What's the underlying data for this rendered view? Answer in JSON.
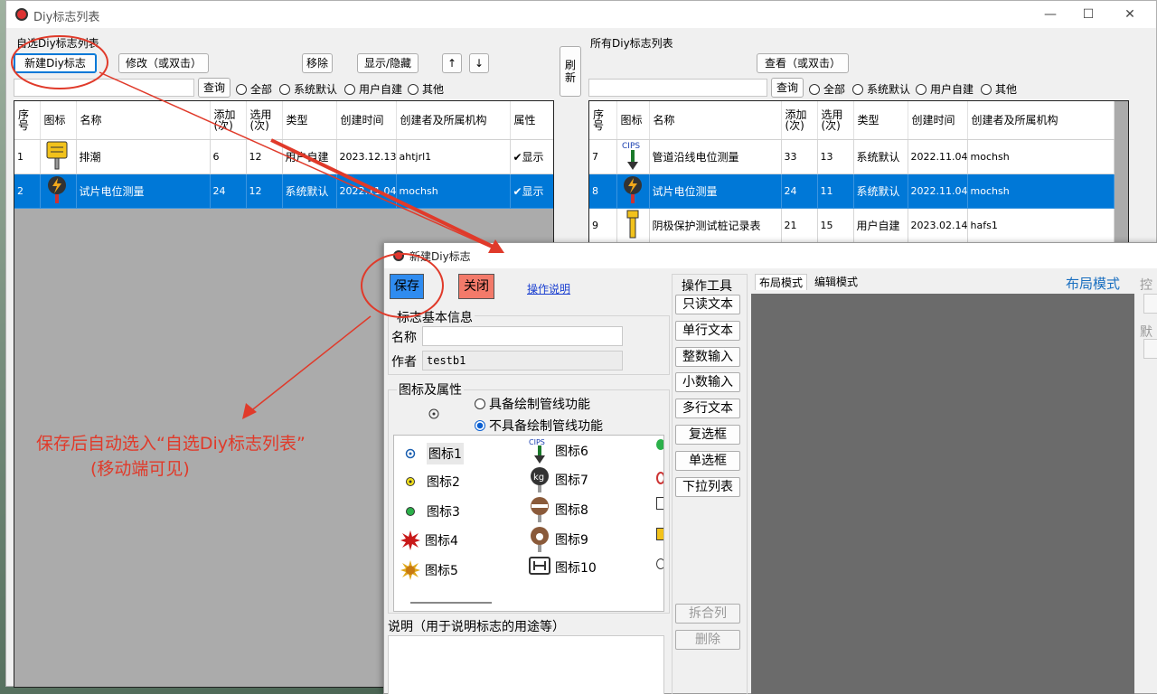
{
  "window": {
    "title": "Diy标志列表",
    "min": "—",
    "max": "☐",
    "close": "✕"
  },
  "left": {
    "section_label": "自选Diy标志列表",
    "new_btn": "新建Diy标志",
    "edit_btn": "修改（或双击）",
    "remove_btn": "移除",
    "toggle_btn": "显示/隐藏",
    "up_btn": "↑",
    "down_btn": "↓",
    "search_value": "",
    "query_btn": "查询",
    "filters": [
      "全部",
      "系统默认",
      "用户自建",
      "其他"
    ],
    "columns": [
      "序号",
      "图标",
      "名称",
      "添加(次)",
      "选用(次)",
      "类型",
      "创建时间",
      "创建者及所属机构",
      "属性"
    ],
    "rows": [
      {
        "no": "1",
        "name": "排潮",
        "add": "6",
        "use": "12",
        "type": "用户自建",
        "date": "2023.12.13",
        "creator": "ahtjrl1",
        "attr": "✔显示",
        "icon": "yellow-sign-icon",
        "selected": false
      },
      {
        "no": "2",
        "name": "试片电位测量",
        "add": "24",
        "use": "12",
        "type": "系统默认",
        "date": "2022.11.04",
        "creator": "mochsh",
        "attr": "✔显示",
        "icon": "lightning-marker-icon",
        "selected": true
      }
    ]
  },
  "refresh_btn": "刷新",
  "right": {
    "section_label": "所有Diy标志列表",
    "view_btn": "查看（或双击）",
    "search_value": "",
    "query_btn": "查询",
    "filters": [
      "全部",
      "系统默认",
      "用户自建",
      "其他"
    ],
    "columns": [
      "序号",
      "图标",
      "名称",
      "添加(次)",
      "选用(次)",
      "类型",
      "创建时间",
      "创建者及所属机构"
    ],
    "rows": [
      {
        "no": "7",
        "name": "管道沿线电位测量",
        "add": "33",
        "use": "13",
        "type": "系统默认",
        "date": "2022.11.04",
        "creator": "mochsh",
        "icon": "cips-arrow-icon",
        "selected": false
      },
      {
        "no": "8",
        "name": "试片电位测量",
        "add": "24",
        "use": "11",
        "type": "系统默认",
        "date": "2022.11.04",
        "creator": "mochsh",
        "icon": "lightning-marker-icon",
        "selected": true
      },
      {
        "no": "9",
        "name": "阴极保护测试桩记录表",
        "add": "21",
        "use": "15",
        "type": "用户自建",
        "date": "2023.02.14",
        "creator": "hafs1",
        "icon": "test-post-icon",
        "selected": false
      }
    ]
  },
  "dialog": {
    "title": "新建Diy标志",
    "save_btn": "保存",
    "close_btn": "关闭",
    "help_link": "操作说明",
    "basic_group": "标志基本信息",
    "name_label": "名称",
    "name_value": "",
    "author_label": "作者",
    "author_value": "testb1",
    "icon_group": "图标及属性",
    "opt_draw": "具备绘制管线功能",
    "opt_nodraw": "不具备绘制管线功能",
    "icons_col1": [
      "图标1",
      "图标2",
      "图标3",
      "图标4",
      "图标5"
    ],
    "icons_col2": [
      "图标6",
      "图标7",
      "图标8",
      "图标9",
      "图标10"
    ],
    "desc_label": "说明（用于说明标志的用途等）",
    "tools_label": "操作工具",
    "tools": [
      "只读文本",
      "单行文本",
      "整数输入",
      "小数输入",
      "多行文本",
      "复选框",
      "单选框",
      "下拉列表"
    ],
    "split_btn": "拆合列",
    "delete_btn": "删除",
    "tab_layout": "布局模式",
    "tab_edit": "编辑模式",
    "mode_title": "布局模式",
    "side_frag1": "控",
    "side_frag2": "默"
  },
  "annotation": {
    "line1": "保存后自动选入“自选Diy标志列表”",
    "line2": "(移动端可见)",
    "color": "#e03a2a"
  }
}
